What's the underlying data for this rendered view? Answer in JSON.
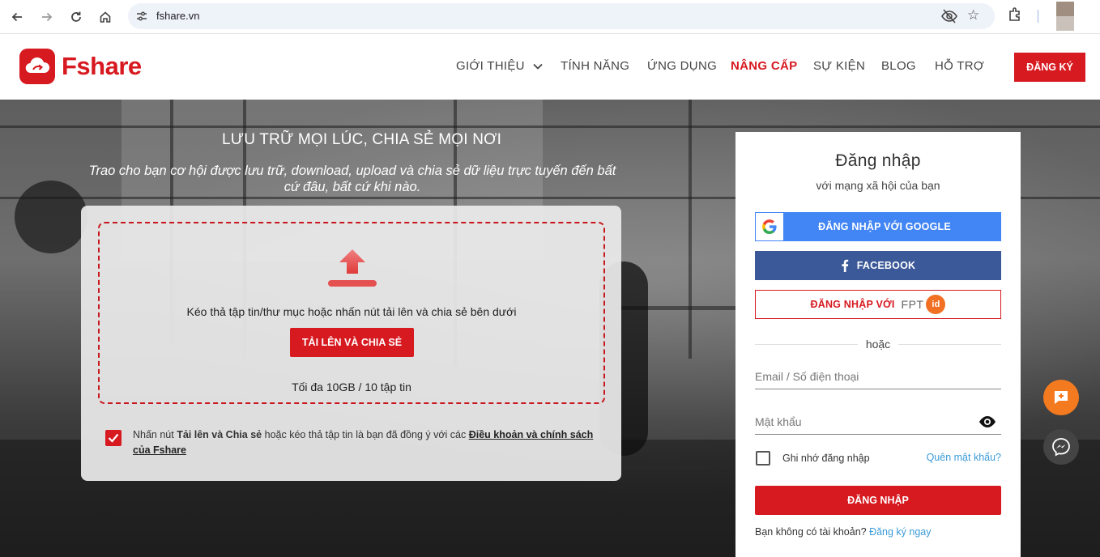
{
  "browser": {
    "url": "fshare.vn",
    "icons": [
      "back-icon",
      "forward-icon",
      "reload-icon",
      "home-icon",
      "site-settings-icon",
      "eye-off-icon",
      "star-icon",
      "extensions-icon"
    ]
  },
  "header": {
    "brand": "Fshare",
    "nav": [
      "GIỚI THIỆU",
      "TÍNH NĂNG",
      "ỨNG DỤNG",
      "NÂNG CẤP",
      "SỰ KIỆN",
      "BLOG",
      "HỖ TRỢ"
    ],
    "active_nav": "NÂNG CẤP",
    "register_label": "ĐĂNG KÝ"
  },
  "hero": {
    "title": "LƯU TRỮ MỌI LÚC, CHIA SẺ MỌI NƠI",
    "subtitle": "Trao cho bạn cơ hội được lưu trữ, download, upload và chia sẻ dữ liệu trực tuyến đến bất cứ đâu, bất cứ khi nào."
  },
  "upload": {
    "drop_text": "Kéo thả tập tin/thư mục hoặc nhấn nút tải lên và chia sẻ bên dưới",
    "button_label": "TẢI LÊN VÀ CHIA SẺ",
    "limit_text": "Tối đa 10GB / 10 tập tin",
    "agree_prefix": "Nhấn nút ",
    "agree_bold": "Tải lên và Chia sẻ",
    "agree_middle": " hoặc kéo thả tập tin là bạn đã đồng ý với các ",
    "agree_link": "Điều khoản và chính sách của Fshare",
    "agree_checked": true
  },
  "login": {
    "title": "Đăng nhập",
    "subtitle": "với mạng xã hội của bạn",
    "google_label": "ĐĂNG NHẬP VỚI GOOGLE",
    "facebook_label": "FACEBOOK",
    "fpt_label": "ĐĂNG NHẬP VỚI",
    "fpt_brand": "FPT",
    "fpt_id": "id",
    "or_text": "hoặc",
    "email_placeholder": "Email / Số điện thoại",
    "password_placeholder": "Mật khẩu",
    "remember_label": "Ghi nhớ đăng nhập",
    "forgot_label": "Quên mật khẩu?",
    "submit_label": "ĐĂNG NHẬP",
    "signup_prompt": "Bạn không có tài khoản? ",
    "signup_link": "Đăng ký ngay"
  },
  "colors": {
    "brand_red": "#d71920",
    "google_blue": "#4285f4",
    "facebook_blue": "#3b5998",
    "link_blue": "#3b9bd8",
    "fab_orange": "#f47a20"
  }
}
